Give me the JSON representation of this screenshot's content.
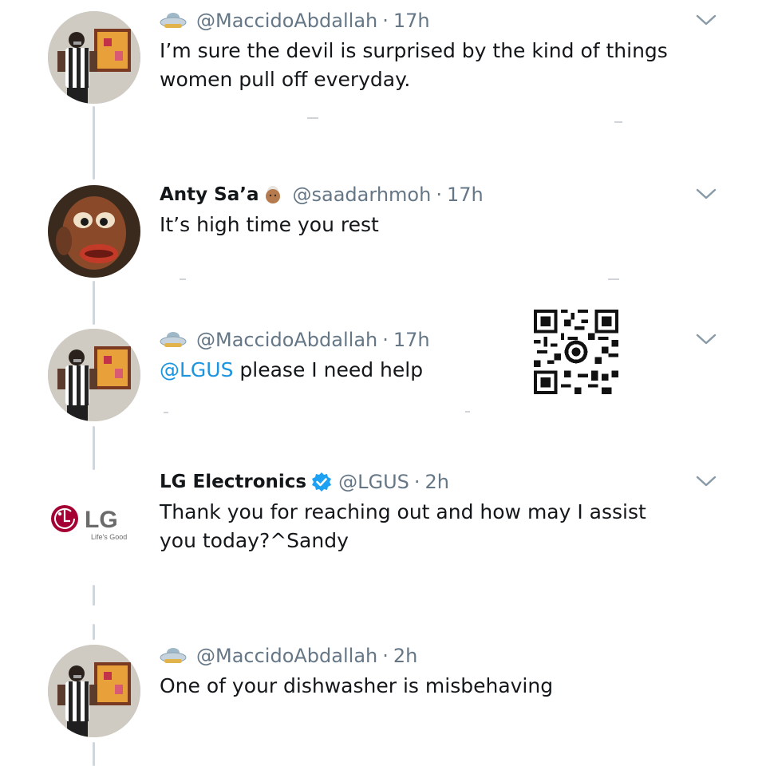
{
  "tweets": [
    {
      "handle": "@MaccidoAbdallah",
      "sep": "·",
      "time": "17h",
      "text": "I’m sure the devil is surprised by the kind of things women pull off everyday.",
      "avatar": "user-avatar-photo",
      "icon": "ufo-emoji-icon"
    },
    {
      "name": "Anty Sa’a",
      "handle": "@saadarhmoh",
      "sep": "·",
      "time": "17h",
      "text": "It’s high time you rest",
      "avatar": "cartoon-fish-avatar",
      "icon": "old-woman-emoji-icon"
    },
    {
      "handle": "@MaccidoAbdallah",
      "sep": "·",
      "time": "17h",
      "mention": "@LGUS",
      "text": " please I need help",
      "avatar": "user-avatar-photo",
      "icon": "ufo-emoji-icon"
    },
    {
      "name": "LG Electronics",
      "handle": "@LGUS",
      "sep": "·",
      "time": "2h",
      "text": "Thank you for reaching out and how may I assist you today?^Sandy",
      "avatar": "lg-logo",
      "icon": "verified-badge-icon",
      "logo_text": "LG",
      "logo_tagline": "Life's Good"
    },
    {
      "handle": "@MaccidoAbdallah",
      "sep": "·",
      "time": "2h",
      "text": "One of your dishwasher is misbehaving",
      "avatar": "user-avatar-photo",
      "icon": "ufo-emoji-icon"
    }
  ],
  "colors": {
    "text": "#14171a",
    "secondary": "#657786",
    "link": "#1b95e0",
    "verified": "#1da1f2",
    "lg_red": "#a50034",
    "thread_line": "#cfd6dc"
  },
  "overlay": {
    "icon": "whatsapp-qr-code"
  }
}
